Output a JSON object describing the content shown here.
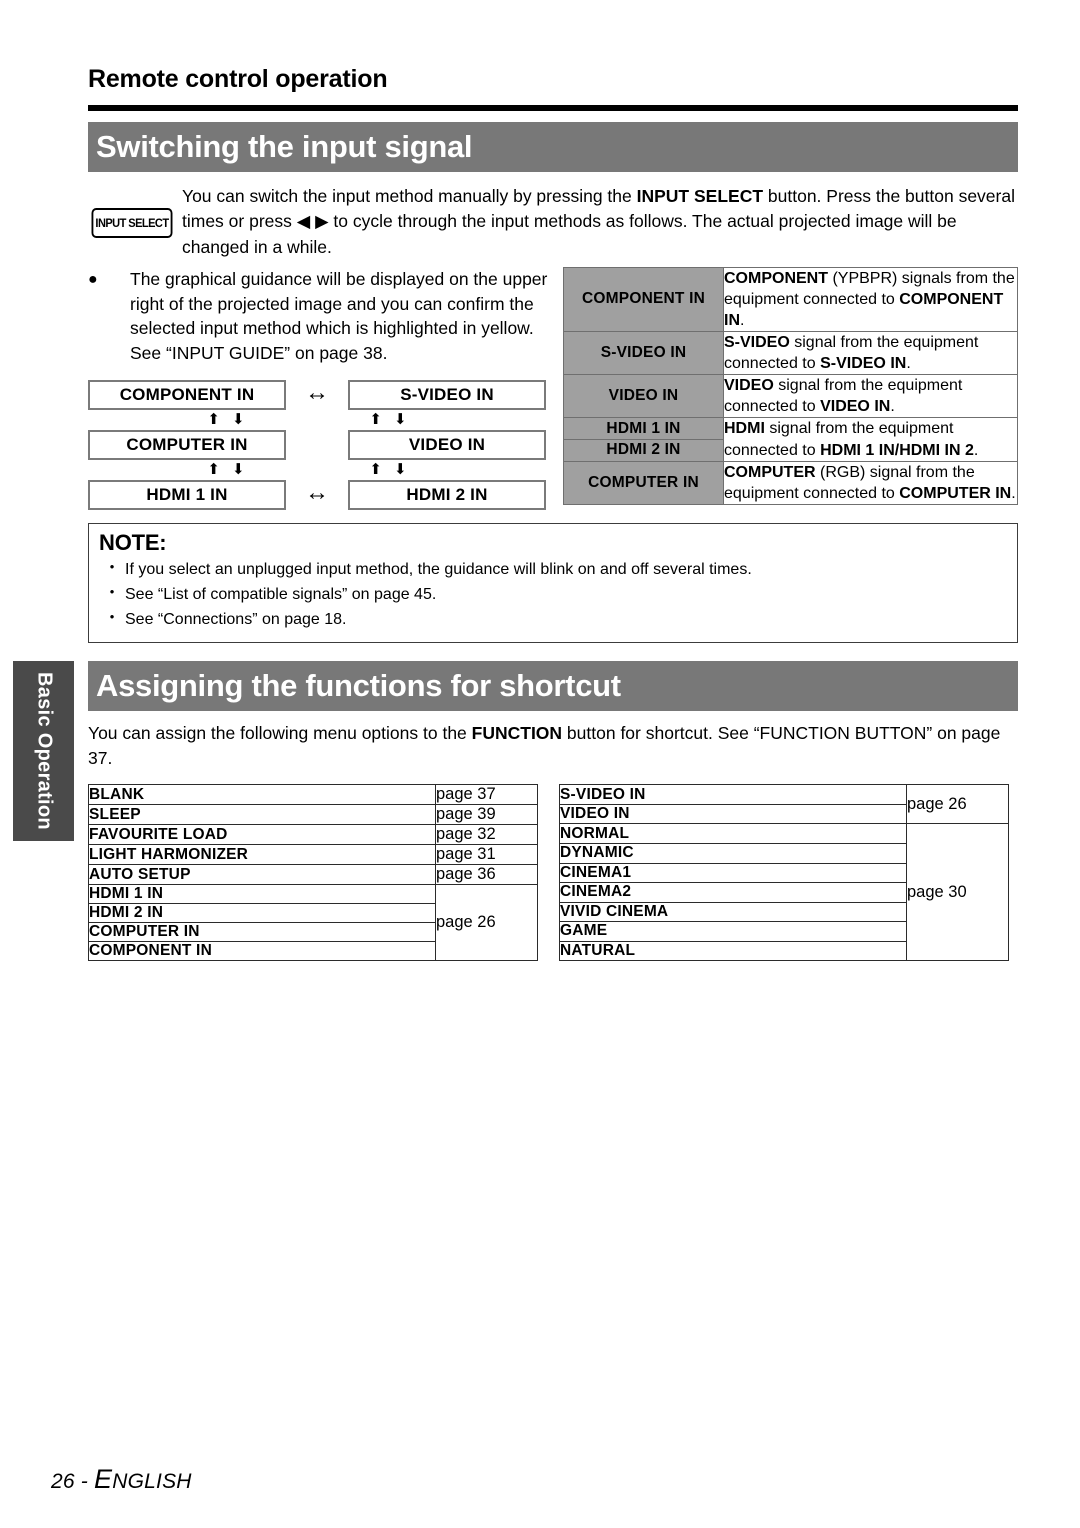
{
  "side_tab": {
    "label": "Basic Operation"
  },
  "running_head": "Remote control operation",
  "section1": {
    "banner_title": "Switching the input signal",
    "button_label": "INPUT SELECT",
    "intro": {
      "part1": "You can switch the input method manually by pressing the ",
      "bold1": "INPUT SELECT",
      "part2": " button. Press the button several times or press ",
      "arrow_left": "◀",
      "arrow_right": "▶",
      "part3": " to cycle through the input methods as follows. The actual projected image will be changed in a while."
    },
    "bullet": "The graphical guidance will be displayed on the upper right of the projected image and you can confirm the selected input method which is highlighted in yellow. See “INPUT GUIDE” on page 38.",
    "bullet_marker": "●",
    "diagram": {
      "boxes": [
        {
          "label": "COMPONENT IN",
          "col": 1,
          "row": 1
        },
        {
          "label": "S-VIDEO IN",
          "col": 2,
          "row": 1
        },
        {
          "label": "COMPUTER IN",
          "col": 1,
          "row": 2
        },
        {
          "label": "VIDEO IN",
          "col": 2,
          "row": 2
        },
        {
          "label": "HDMI 1 IN",
          "col": 1,
          "row": 3
        },
        {
          "label": "HDMI 2 IN",
          "col": 2,
          "row": 3
        }
      ],
      "h_arrow": "↔",
      "up_arrow": "⬆",
      "down_arrow": "⬇"
    },
    "signal_table": [
      {
        "name": "COMPONENT IN",
        "desc_parts": [
          {
            "t": "COMPONENT",
            "b": true
          },
          {
            "t": " (YPBPR) signals from the equipment connected to ",
            "b": false
          },
          {
            "t": "COMPONENT IN",
            "b": true
          },
          {
            "t": ".",
            "b": false
          }
        ]
      },
      {
        "name": "S-VIDEO IN",
        "desc_parts": [
          {
            "t": "S-VIDEO",
            "b": true
          },
          {
            "t": " signal from the equipment connected to ",
            "b": false
          },
          {
            "t": "S-VIDEO IN",
            "b": true
          },
          {
            "t": ".",
            "b": false
          }
        ]
      },
      {
        "name": "VIDEO IN",
        "desc_parts": [
          {
            "t": "VIDEO",
            "b": true
          },
          {
            "t": " signal from the equipment connected to ",
            "b": false
          },
          {
            "t": "VIDEO IN",
            "b": true
          },
          {
            "t": ".",
            "b": false
          }
        ]
      },
      {
        "name": "HDMI 1 IN",
        "span_with_next": true,
        "desc_parts": [
          {
            "t": "HDMI",
            "b": true
          },
          {
            "t": " signal from the equipment connected to ",
            "b": false
          },
          {
            "t": "HDMI 1 IN/HDMI IN 2",
            "b": true
          },
          {
            "t": ".",
            "b": false
          }
        ]
      },
      {
        "name": "HDMI 2 IN",
        "merged_into_previous": true
      },
      {
        "name": "COMPUTER IN",
        "desc_parts": [
          {
            "t": "COMPUTER",
            "b": true
          },
          {
            "t": " (RGB) signal from the equipment connected to ",
            "b": false
          },
          {
            "t": "COMPUTER IN",
            "b": true
          },
          {
            "t": ".",
            "b": false
          }
        ]
      }
    ],
    "note": {
      "title": "NOTE:",
      "bullet_marker": "•",
      "items": [
        "If you select an unplugged input method, the guidance will blink on and off several times.",
        "See “List of compatible signals” on page 45.",
        "See “Connections” on page 18."
      ]
    }
  },
  "section2": {
    "banner_title": "Assigning the functions for shortcut",
    "intro": {
      "part1": "You can assign the following menu options to the ",
      "bold1": "FUNCTION",
      "part2": " button for shortcut. See “FUNCTION BUTTON” on page 37."
    },
    "left_table": [
      {
        "name": "BLANK",
        "page": "page 37",
        "rowspan": 1
      },
      {
        "name": "SLEEP",
        "page": "page 39",
        "rowspan": 1
      },
      {
        "name": "FAVOURITE LOAD",
        "page": "page 32",
        "rowspan": 1
      },
      {
        "name": "LIGHT HARMONIZER",
        "page": "page 31",
        "rowspan": 1
      },
      {
        "name": "AUTO SETUP",
        "page": "page 36",
        "rowspan": 1
      },
      {
        "name": "HDMI 1 IN",
        "page": "page 26",
        "rowspan": 4
      },
      {
        "name": "HDMI 2 IN",
        "page": null,
        "rowspan": 0
      },
      {
        "name": "COMPUTER IN",
        "page": null,
        "rowspan": 0
      },
      {
        "name": "COMPONENT IN",
        "page": null,
        "rowspan": 0
      }
    ],
    "right_table": [
      {
        "name": "S-VIDEO IN",
        "page": "page 26",
        "rowspan": 2
      },
      {
        "name": "VIDEO IN",
        "page": null,
        "rowspan": 0
      },
      {
        "name": "NORMAL",
        "page": "page 30",
        "rowspan": 7
      },
      {
        "name": "DYNAMIC",
        "page": null,
        "rowspan": 0
      },
      {
        "name": "CINEMA1",
        "page": null,
        "rowspan": 0
      },
      {
        "name": "CINEMA2",
        "page": null,
        "rowspan": 0
      },
      {
        "name": "VIVID CINEMA",
        "page": null,
        "rowspan": 0
      },
      {
        "name": "GAME",
        "page": null,
        "rowspan": 0
      },
      {
        "name": "NATURAL",
        "page": null,
        "rowspan": 0
      }
    ]
  },
  "footer": {
    "page_number": "26",
    "separator": " - ",
    "language_first": "E",
    "language_rest": "NGLISH"
  },
  "colors": {
    "banner_gray": "#787878",
    "table_header_gray": "#a0a0a0",
    "side_tab_gray": "#4a4a4a",
    "rule_black": "#000000"
  }
}
